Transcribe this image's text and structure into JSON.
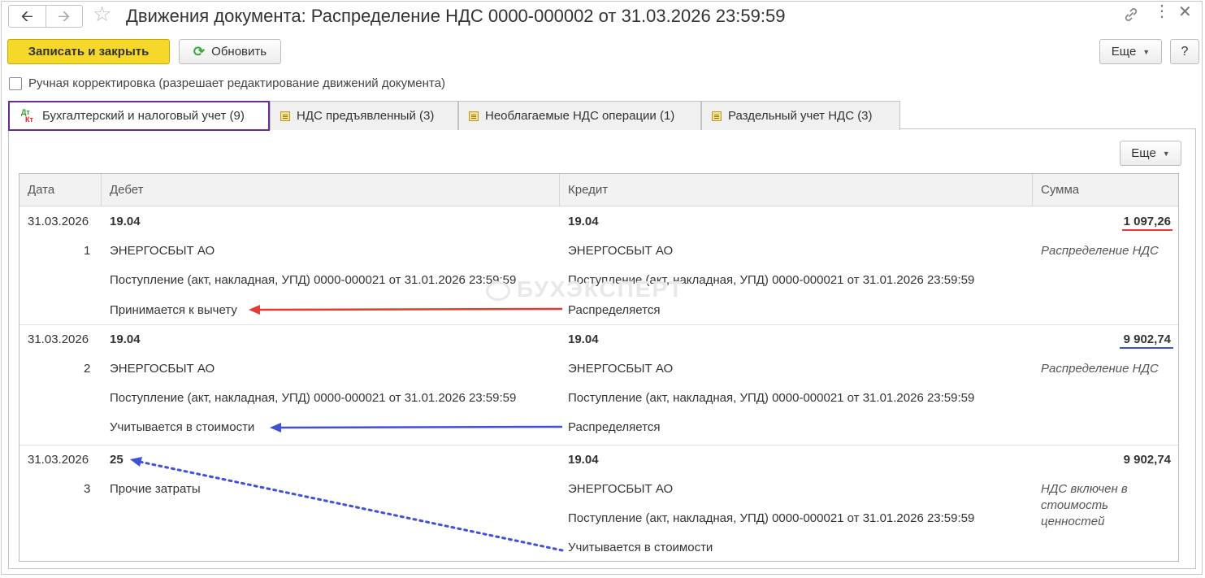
{
  "window": {
    "title": "Движения документа: Распределение НДС 0000-000002 от 31.03.2026 23:59:59"
  },
  "toolbar": {
    "save_close_label": "Записать и закрыть",
    "refresh_label": "Обновить",
    "more_label": "Еще",
    "help_label": "?"
  },
  "manual_edit": {
    "label": "Ручная корректировка (разрешает редактирование движений документа)",
    "checked": false
  },
  "tabs": [
    {
      "label": "Бухгалтерский и налоговый учет (9)",
      "active": true
    },
    {
      "label": "НДС предъявленный (3)",
      "active": false
    },
    {
      "label": "Необлагаемые НДС операции (1)",
      "active": false
    },
    {
      "label": "Раздельный учет НДС (3)",
      "active": false
    }
  ],
  "table_toolbar": {
    "more_label": "Еще"
  },
  "table": {
    "columns": [
      "Дата",
      "Дебет",
      "Кредит",
      "Сумма"
    ],
    "rows": [
      {
        "date": "31.03.2026",
        "num": "1",
        "debit": [
          "19.04",
          "ЭНЕРГОСБЫТ АО",
          "Поступление (акт, накладная, УПД) 0000-000021 от 31.01.2026 23:59:59",
          "Принимается к вычету"
        ],
        "credit": [
          "19.04",
          "ЭНЕРГОСБЫТ АО",
          "Поступление (акт, накладная, УПД) 0000-000021 от 31.01.2026 23:59:59",
          "Распределяется"
        ],
        "amount": "1 097,26",
        "content": [
          "Распределение НДС"
        ]
      },
      {
        "date": "31.03.2026",
        "num": "2",
        "debit": [
          "19.04",
          "ЭНЕРГОСБЫТ АО",
          "Поступление (акт, накладная, УПД) 0000-000021 от 31.01.2026 23:59:59",
          "Учитывается в стоимости"
        ],
        "credit": [
          "19.04",
          "ЭНЕРГОСБЫТ АО",
          "Поступление (акт, накладная, УПД) 0000-000021 от 31.01.2026 23:59:59",
          "Распределяется"
        ],
        "amount": "9 902,74",
        "content": [
          "Распределение НДС"
        ]
      },
      {
        "date": "31.03.2026",
        "num": "3",
        "debit": [
          "25",
          "Прочие затраты",
          "",
          ""
        ],
        "credit": [
          "19.04",
          "ЭНЕРГОСБЫТ АО",
          "Поступление (акт, накладная, УПД) 0000-000021 от 31.01.2026 23:59:59",
          "Учитывается в стоимости"
        ],
        "amount": "9 902,74",
        "content": [
          "НДС включен в",
          "стоимость",
          "ценностей"
        ]
      }
    ]
  },
  "watermark": "БУХЭКСПЕРТ",
  "colors": {
    "primary_button": "#f5d829",
    "active_tab_border": "#6a2c91",
    "arrow_red": "#e53935",
    "arrow_blue": "#3f51d8"
  }
}
